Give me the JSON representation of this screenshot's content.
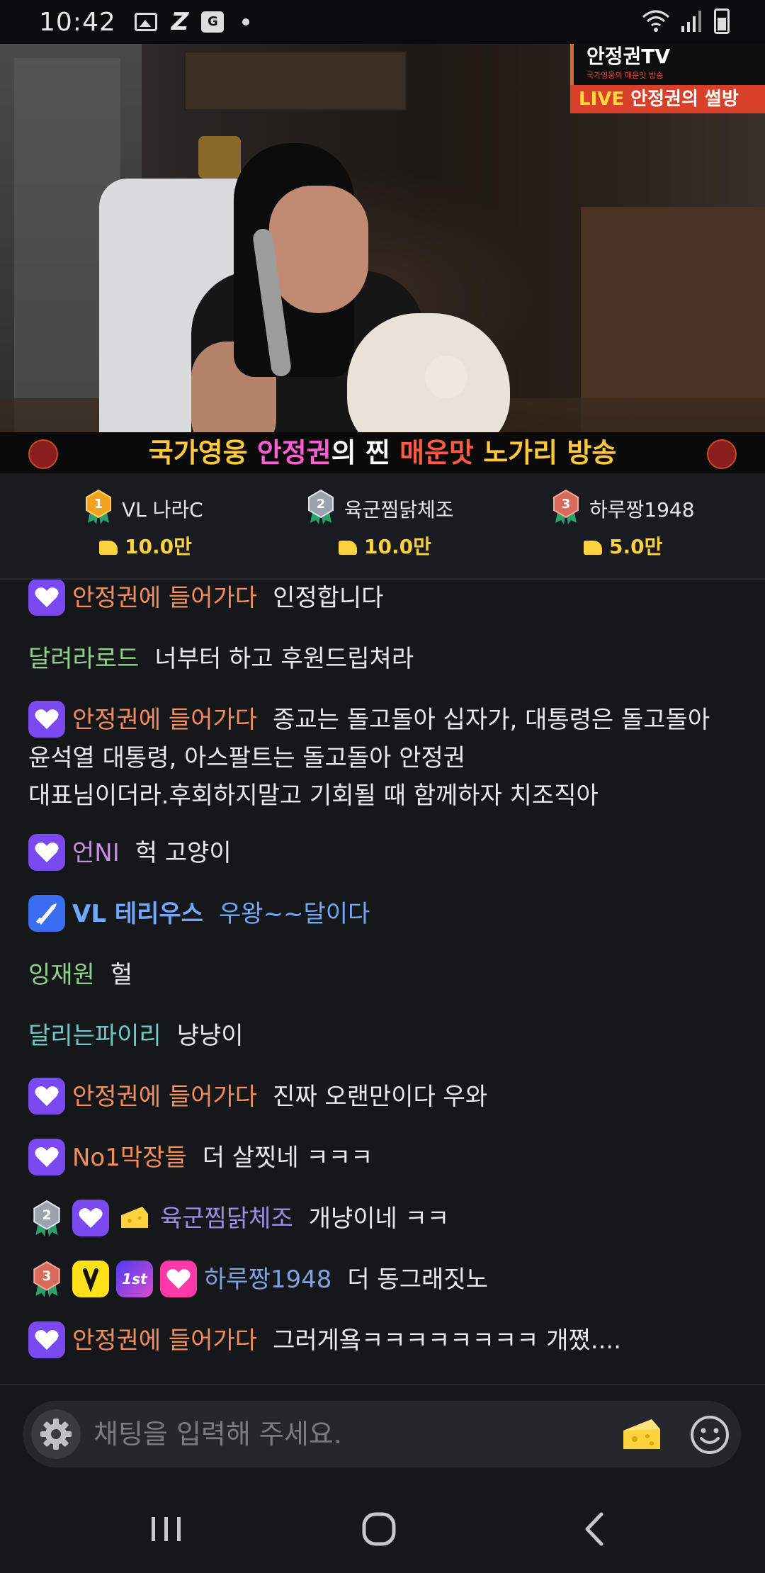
{
  "status_bar": {
    "time": "10:42",
    "app_icon_label": "G"
  },
  "video": {
    "channel_title": "안정권TV",
    "channel_subtitle": "국가영웅의 매운맛 방송",
    "live_word": "LIVE",
    "live_label": "안정권의 썰방",
    "banner": {
      "part1": "국가영웅 ",
      "part2": "안정권",
      "part3": "의 찐 ",
      "part4": "매운맛",
      "part5": " 노가리 방송"
    }
  },
  "leaderboard": [
    {
      "rank": 1,
      "name": "VL 나라C",
      "amount": "10.0만"
    },
    {
      "rank": 2,
      "name": "육군찜닭체조",
      "amount": "10.0만"
    },
    {
      "rank": 3,
      "name": "하루짱1948",
      "amount": "5.0만"
    }
  ],
  "chat": {
    "messages": [
      {
        "nick": "안정권에 들어가다",
        "text": "인정합니다"
      },
      {
        "nick": "달려라로드",
        "text": "너부터 하고 후원드립쳐라"
      },
      {
        "nick": "안정권에 들어가다",
        "text": "종교는 돌고돌아 십자가, 대통령은 돌고돌아",
        "line2": "윤석열 대통령, 아스팔트는 돌고돌아 안정권",
        "line3": "대표님이더라.후회하지말고 기회될 때 함께하자 치조직아"
      },
      {
        "nick": "언NI",
        "text": "헉 고양이"
      },
      {
        "nick": "VL 테리우스",
        "text": "우왕~~달이다"
      },
      {
        "nick": "잉재원",
        "text": "헐"
      },
      {
        "nick": "달리는파이리",
        "text": "냥냥이"
      },
      {
        "nick": "안정권에 들어가다",
        "text": "진짜 오랜만이다 우와"
      },
      {
        "nick": "No1막장들",
        "text": "더 살찟네 ㅋㅋㅋ"
      },
      {
        "nick": "육군찜닭체조",
        "text": "개냥이네 ㅋㅋ"
      },
      {
        "nick": "하루짱1948",
        "text": "더 동그래짓노",
        "badge_1st": "1st"
      },
      {
        "nick": "안정권에 들어가다",
        "text": "그러게욬ㅋㅋㅋㅋㅋㅋㅋㅋ 개쪘...."
      }
    ]
  },
  "input": {
    "placeholder": "채팅을 입력해 주세요."
  },
  "colors": {
    "background": "#16171b",
    "accent_purple": "#7b49f0",
    "amount_yellow": "#ffd23f",
    "nick_orange": "#f58d5a",
    "nick_green": "#8fd08b",
    "nick_blue": "#6fa9ff"
  },
  "icons": {
    "status": [
      "image-icon",
      "z-icon",
      "g-app-icon",
      "wifi-icon",
      "signal-icon",
      "battery-icon"
    ],
    "input": [
      "gear-icon",
      "cheese-icon",
      "emoji-icon"
    ],
    "nav": [
      "recents-icon",
      "home-icon",
      "back-icon"
    ]
  }
}
